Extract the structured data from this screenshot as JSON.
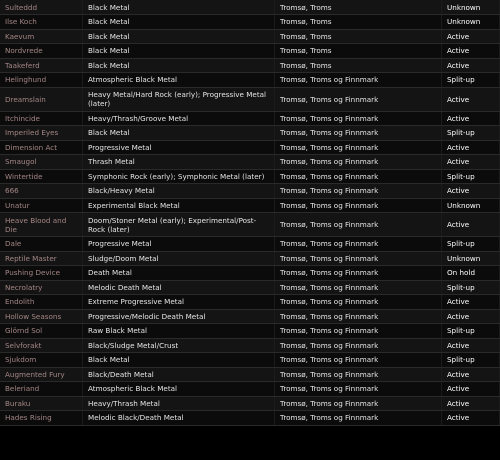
{
  "colors": {
    "active": "#5fbf2f",
    "unknown": "#e06a3a",
    "split_up": "#c01f1f",
    "on_hold": "#f0d500",
    "band_name": "#a58686"
  },
  "rows": [
    {
      "name": "Sulteddd",
      "genre": "Black Metal",
      "location": "Tromsø, Troms",
      "status": "Unknown",
      "status_class": "unknown"
    },
    {
      "name": "Ilse Koch",
      "genre": "Black Metal",
      "location": "Tromsø, Troms",
      "status": "Unknown",
      "status_class": "unknown"
    },
    {
      "name": "Kaevum",
      "genre": "Black Metal",
      "location": "Tromsø, Troms",
      "status": "Active",
      "status_class": "active"
    },
    {
      "name": "Nordvrede",
      "genre": "Black Metal",
      "location": "Tromsø, Troms",
      "status": "Active",
      "status_class": "active"
    },
    {
      "name": "Taakeferd",
      "genre": "Black Metal",
      "location": "Tromsø, Troms",
      "status": "Active",
      "status_class": "active"
    },
    {
      "name": "Helinghund",
      "genre": "Atmospheric Black Metal",
      "location": "Tromsø, Troms og Finnmark",
      "status": "Split-up",
      "status_class": "split-up"
    },
    {
      "name": "Dreamslain",
      "genre": "Heavy Metal/Hard Rock (early); Progressive Metal (later)",
      "location": "Tromsø, Troms og Finnmark",
      "status": "Active",
      "status_class": "active",
      "tall": true
    },
    {
      "name": "Itchincide",
      "genre": "Heavy/Thrash/Groove Metal",
      "location": "Tromsø, Troms og Finnmark",
      "status": "Active",
      "status_class": "active"
    },
    {
      "name": "Imperiled Eyes",
      "genre": "Black Metal",
      "location": "Tromsø, Troms og Finnmark",
      "status": "Split-up",
      "status_class": "split-up"
    },
    {
      "name": "Dimension Act",
      "genre": "Progressive Metal",
      "location": "Tromsø, Troms og Finnmark",
      "status": "Active",
      "status_class": "active"
    },
    {
      "name": "Smaugol",
      "genre": "Thrash Metal",
      "location": "Tromsø, Troms og Finnmark",
      "status": "Active",
      "status_class": "active"
    },
    {
      "name": "Wintertide",
      "genre": "Symphonic Rock (early); Symphonic Metal (later)",
      "location": "Tromsø, Troms og Finnmark",
      "status": "Split-up",
      "status_class": "split-up"
    },
    {
      "name": "666",
      "genre": "Black/Heavy Metal",
      "location": "Tromsø, Troms og Finnmark",
      "status": "Active",
      "status_class": "active"
    },
    {
      "name": "Unatur",
      "genre": "Experimental Black Metal",
      "location": "Tromsø, Troms og Finnmark",
      "status": "Unknown",
      "status_class": "unknown"
    },
    {
      "name": "Heave Blood and Die",
      "genre": "Doom/Stoner Metal (early); Experimental/Post-Rock (later)",
      "location": "Tromsø, Troms og Finnmark",
      "status": "Active",
      "status_class": "active",
      "tall": true
    },
    {
      "name": "Dale",
      "genre": "Progressive Metal",
      "location": "Tromsø, Troms og Finnmark",
      "status": "Split-up",
      "status_class": "split-up"
    },
    {
      "name": "Reptile Master",
      "genre": "Sludge/Doom Metal",
      "location": "Tromsø, Troms og Finnmark",
      "status": "Unknown",
      "status_class": "unknown"
    },
    {
      "name": "Pushing Device",
      "genre": "Death Metal",
      "location": "Tromsø, Troms og Finnmark",
      "status": "On hold",
      "status_class": "on-hold"
    },
    {
      "name": "Necrolatry",
      "genre": "Melodic Death Metal",
      "location": "Tromsø, Troms og Finnmark",
      "status": "Split-up",
      "status_class": "split-up"
    },
    {
      "name": "Endolith",
      "genre": "Extreme Progressive Metal",
      "location": "Tromsø, Troms og Finnmark",
      "status": "Active",
      "status_class": "active"
    },
    {
      "name": "Hollow Seasons",
      "genre": "Progressive/Melodic Death Metal",
      "location": "Tromsø, Troms og Finnmark",
      "status": "Active",
      "status_class": "active"
    },
    {
      "name": "Glörnd Sol",
      "genre": "Raw Black Metal",
      "location": "Tromsø, Troms og Finnmark",
      "status": "Split-up",
      "status_class": "split-up"
    },
    {
      "name": "Selvforakt",
      "genre": "Black/Sludge Metal/Crust",
      "location": "Tromsø, Troms og Finnmark",
      "status": "Active",
      "status_class": "active"
    },
    {
      "name": "Sjukdom",
      "genre": "Black Metal",
      "location": "Tromsø, Troms og Finnmark",
      "status": "Split-up",
      "status_class": "split-up"
    },
    {
      "name": "Augmented Fury",
      "genre": "Black/Death Metal",
      "location": "Tromsø, Troms og Finnmark",
      "status": "Active",
      "status_class": "active"
    },
    {
      "name": "Beleriand",
      "genre": "Atmospheric Black Metal",
      "location": "Tromsø, Troms og Finnmark",
      "status": "Active",
      "status_class": "active"
    },
    {
      "name": "Buraku",
      "genre": "Heavy/Thrash Metal",
      "location": "Tromsø, Troms og Finnmark",
      "status": "Active",
      "status_class": "active"
    },
    {
      "name": "Hades Rising",
      "genre": "Melodic Black/Death Metal",
      "location": "Tromsø, Troms og Finnmark",
      "status": "Active",
      "status_class": "active"
    }
  ]
}
